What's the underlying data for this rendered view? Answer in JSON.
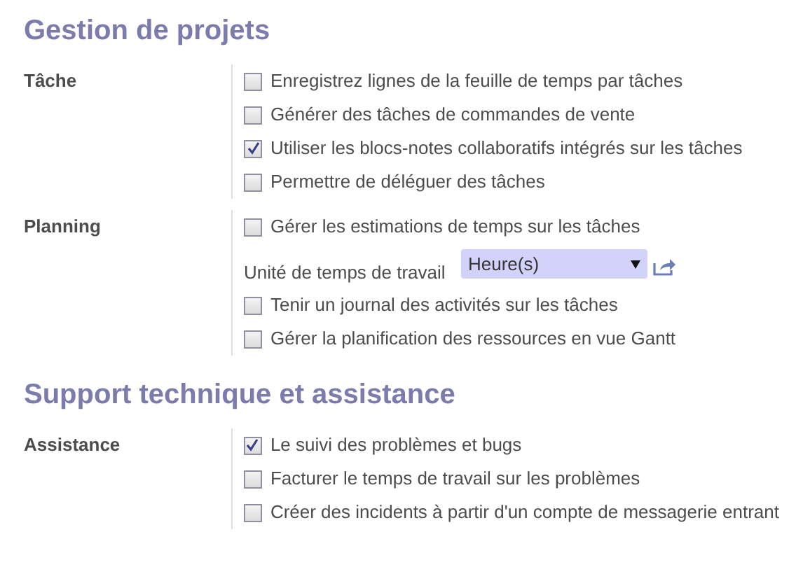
{
  "sections": [
    {
      "title": "Gestion de projets",
      "groups": [
        {
          "label": "Tâche",
          "items": [
            {
              "kind": "checkbox",
              "label": "Enregistrez lignes de la feuille de temps par tâches",
              "checked": false
            },
            {
              "kind": "checkbox",
              "label": "Générer des tâches de commandes de vente",
              "checked": false
            },
            {
              "kind": "checkbox",
              "label": "Utiliser les blocs-notes collaboratifs intégrés sur les tâches",
              "checked": true
            },
            {
              "kind": "checkbox",
              "label": "Permettre de déléguer des tâches",
              "checked": false
            }
          ]
        },
        {
          "label": "Planning",
          "items": [
            {
              "kind": "checkbox",
              "label": "Gérer les estimations de temps sur les tâches",
              "checked": false
            },
            {
              "kind": "select",
              "label": "Unité de temps de travail",
              "value": "Heure(s)"
            },
            {
              "kind": "checkbox",
              "label": "Tenir un journal des activités sur les tâches",
              "checked": false
            },
            {
              "kind": "checkbox",
              "label": "Gérer la planification des ressources en vue Gantt",
              "checked": false
            }
          ]
        }
      ]
    },
    {
      "title": "Support technique et assistance",
      "groups": [
        {
          "label": "Assistance",
          "items": [
            {
              "kind": "checkbox",
              "label": "Le suivi des problèmes et bugs",
              "checked": true
            },
            {
              "kind": "checkbox",
              "label": "Facturer le temps de travail sur les problèmes",
              "checked": false
            },
            {
              "kind": "checkbox",
              "label": "Créer des incidents à partir d'un compte de messagerie entrant",
              "checked": false
            }
          ]
        }
      ]
    }
  ]
}
